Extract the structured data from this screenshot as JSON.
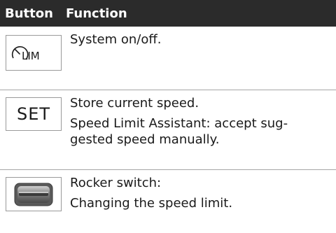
{
  "table": {
    "header": {
      "button_col": "Button",
      "function_col": "Function"
    },
    "rows": [
      {
        "icon": "speed-limit-lim-icon",
        "icon_text": "LIM",
        "lines": [
          "System on/off."
        ]
      },
      {
        "icon": "set-button-icon",
        "icon_text": "SET",
        "lines": [
          "Store current speed.",
          "Speed Limit Assistant: accept sug-gested speed manually."
        ]
      },
      {
        "icon": "rocker-switch-icon",
        "lines": [
          "Rocker switch:",
          "Changing the speed limit."
        ]
      }
    ]
  },
  "colors": {
    "header_bg": "#2b2b2b",
    "header_text": "#ffffff",
    "divider": "#a6a6a6",
    "icon_border": "#9a9a9a"
  }
}
